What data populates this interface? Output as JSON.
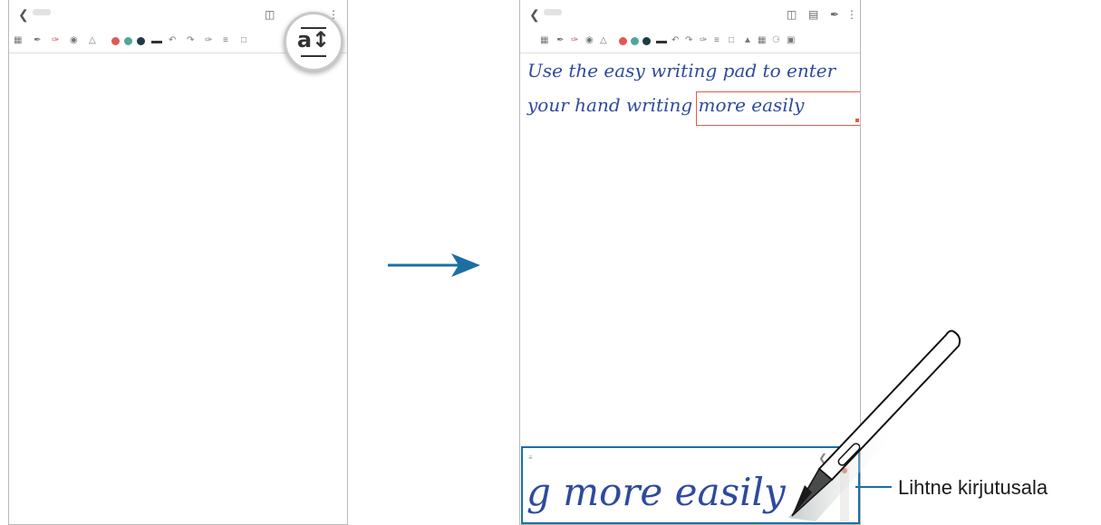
{
  "left_screen": {
    "toolbar_icons": [
      "keyboard-icon",
      "pen-icon",
      "pencil-icon",
      "brush-icon",
      "shape-icon"
    ],
    "colors": [
      "#e05a55",
      "#4fa79a",
      "#1f3b4a"
    ],
    "easy_writing_pad_button_glyph": "a↕"
  },
  "right_screen": {
    "colors": [
      "#e05a55",
      "#4fa79a",
      "#1f3b4a"
    ],
    "handwriting": {
      "line1": "Use the easy writing pad to enter",
      "line2": "your hand writing more easily"
    },
    "pad": {
      "text": "g more easily"
    }
  },
  "annotation": {
    "label": "Lihtne kirjutusala"
  },
  "accent_color": "#1c6fa3"
}
